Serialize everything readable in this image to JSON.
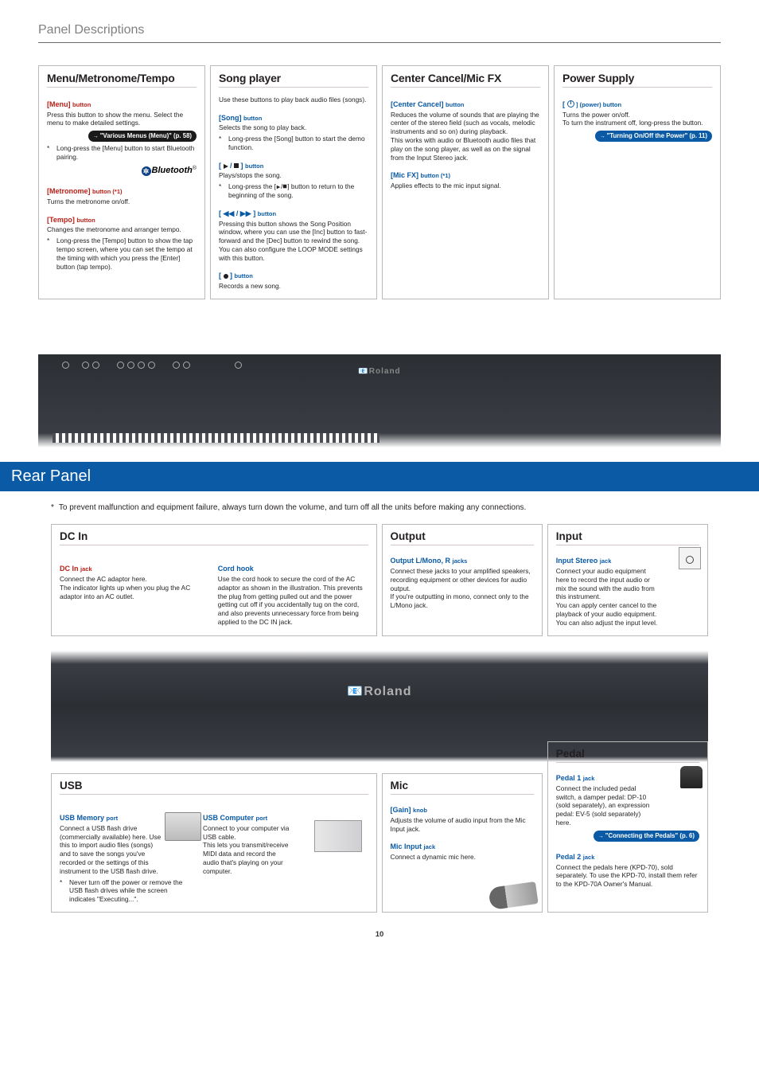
{
  "header": {
    "title": "Panel Descriptions"
  },
  "top": {
    "menu": {
      "title": "Menu/Metronome/Tempo",
      "b1_label": "[Menu]",
      "b1_sub": "button",
      "b1_text": "Press this button to show the menu. Select the menu to make detailed settings.",
      "b1_badge": "\"Various Menus (Menu)\" (p. 58)",
      "b1_note": "Long-press the [Menu] button to start Bluetooth pairing.",
      "bt_brand": "Bluetooth",
      "b2_label": "[Metronome]",
      "b2_sub": "button (*1)",
      "b2_text": "Turns the metronome on/off.",
      "b3_label": "[Tempo]",
      "b3_sub": "button",
      "b3_text": "Changes the metronome and arranger tempo.",
      "b3_note": "Long-press the [Tempo] button to show the tap tempo screen, where you can set the tempo at the timing with which you press the [Enter] button (tap tempo)."
    },
    "song": {
      "title": "Song player",
      "intro": "Use these buttons to play back audio files (songs).",
      "b1_label": "[Song]",
      "b1_sub": "button",
      "b1_text": "Selects the song to play back.",
      "b1_note": "Long-press the [Song] button to start the demo function.",
      "b2_sub": "button",
      "b2_text": "Plays/stops the song.",
      "b2_note_a": "Long-press the [",
      "b2_note_b": "] button to return to the beginning of the song.",
      "b3_sub": "button",
      "b3_text": "Pressing this button shows the Song Position window, where you can use the [Inc] button to fast-forward and the [Dec] button to rewind the song.\nYou can also configure the LOOP MODE settings with this button.",
      "b4_sub": "button",
      "b4_text": "Records a new song."
    },
    "center": {
      "title": "Center Cancel/Mic FX",
      "b1_label": "[Center Cancel]",
      "b1_sub": "button",
      "b1_text": "Reduces the volume of sounds that are playing the center of the stereo field (such as vocals, melodic instruments and so on) during playback.\nThis works with audio or Bluetooth audio files that play on the song player, as well as on the signal from the Input Stereo jack.",
      "b2_label": "[Mic FX]",
      "b2_sub": "button (*1)",
      "b2_text": "Applies effects to the mic input signal."
    },
    "power": {
      "title": "Power Supply",
      "b1_suffix": "] (power) button",
      "b1_text": "Turns the power on/off.\nTo turn the instrument off, long-press the button.",
      "b1_badge": "\"Turning On/Off the Power\" (p. 11)"
    }
  },
  "section_bar": "Rear Panel",
  "caution": "To prevent malfunction and equipment failure, always turn down the volume, and turn off all the units before making any connections.",
  "dcin": {
    "title": "DC In",
    "b1_label": "DC In",
    "b1_sub": "jack",
    "b1_text": "Connect the AC adaptor here.\nThe indicator lights up when you plug the AC adaptor into an AC outlet.",
    "b2_label": "Cord hook",
    "b2_text": "Use the cord hook to secure the cord of the AC adaptor as shown in the illustration. This prevents the plug from getting pulled out and the power getting cut off if you accidentally tug on the cord, and also prevents unnecessary force from being applied to the DC IN jack."
  },
  "output": {
    "title": "Output",
    "b1_label": "Output L/Mono, R",
    "b1_sub": "jacks",
    "b1_text": "Connect these jacks to your amplified speakers, recording equipment or other devices for audio output.\nIf you're outputting in mono, connect only to the L/Mono jack."
  },
  "input": {
    "title": "Input",
    "b1_label": "Input Stereo",
    "b1_sub": "jack",
    "b1_text": "Connect your audio equipment here to record the input audio or mix the sound with the audio from this instrument.\nYou can apply center cancel to the playback of your audio equipment. You can also adjust the input level."
  },
  "usb": {
    "title": "USB",
    "b1_label": "USB Memory",
    "b1_sub": "port",
    "b1_text": "Connect a USB flash drive (commercially available) here. Use this to import audio files (songs) and to save the songs you've recorded or the settings of this instrument to the USB flash drive.",
    "b1_note": "Never turn off the power or remove the USB flash drives while the screen indicates \"Executing...\".",
    "b2_label": "USB Computer",
    "b2_sub": "port",
    "b2_text": "Connect to your computer via USB cable.\nThis lets you transmit/receive MIDI data and record the audio that's playing on your computer."
  },
  "mic": {
    "title": "Mic",
    "b1_label": "[Gain]",
    "b1_sub": "knob",
    "b1_text": "Adjusts the volume of audio input from the Mic Input jack.",
    "b2_label": "Mic Input",
    "b2_sub": "jack",
    "b2_text": "Connect a dynamic mic here."
  },
  "pedal": {
    "title": "Pedal",
    "b1_label": "Pedal 1",
    "b1_sub": "jack",
    "b1_text": "Connect the included pedal switch, a damper pedal: DP-10 (sold separately), an expression pedal: EV-5 (sold separately) here.",
    "b1_badge": "\"Connecting the Pedals\" (p. 6)",
    "b2_label": "Pedal 2",
    "b2_sub": "jack",
    "b2_text": "Connect the pedals here (KPD-70), sold separately. To use the KPD-70, install them refer to the KPD-70A Owner's Manual."
  },
  "pageno": "10",
  "roland": "Roland"
}
